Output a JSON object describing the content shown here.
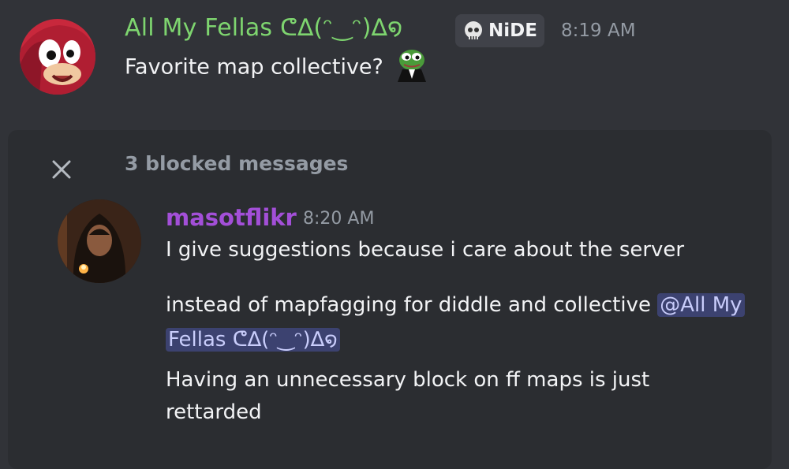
{
  "message1": {
    "author": "All My Fellas ᕦ∆(ᵔ‿ᵔ)∆໑",
    "tag": "NiDE",
    "tag_icon": "skull-icon",
    "timestamp": "8:19 AM",
    "text": "Favorite map collective?",
    "emoji": "pepe-tuxedo-icon",
    "author_color": "#7ed56f"
  },
  "blocked": {
    "label": "3 blocked messages",
    "close_icon": "close-icon"
  },
  "message2": {
    "author": "masotflikr",
    "author_color": "#a34fd8",
    "timestamp": "8:20 AM",
    "line1": "I give suggestions because i care about the server",
    "line2_text": "instead of mapfagging for diddle and collective ",
    "mention_part1": "@All My",
    "mention_part2": "Fellas ᕦ∆(ᵔ‿ᵔ)∆໑",
    "line4": "Having an unnecessary block on ff maps is just",
    "line5": "rettarded"
  }
}
